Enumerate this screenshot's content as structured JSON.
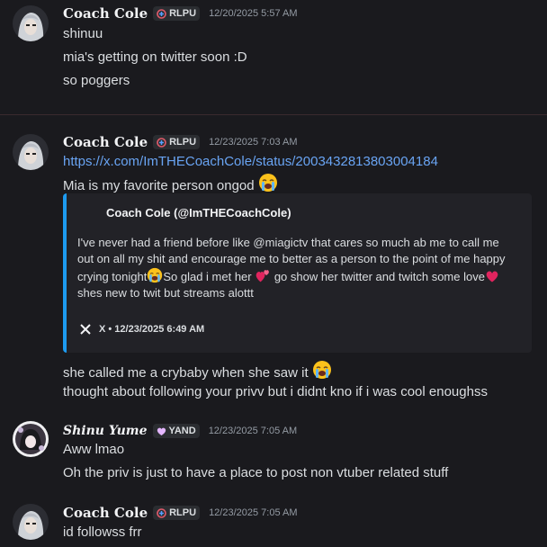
{
  "colors": {
    "background": "#1a1a1e",
    "link": "#69a4f3",
    "embed_accent": "#1d9bf0",
    "heart": "#e0245e"
  },
  "messages": [
    {
      "username": "Coach Cole",
      "tag": "RLPU",
      "timestamp": "12/20/2025 5:57 AM",
      "lines": [
        "shinuu",
        "mia's getting on twitter soon :D",
        "so poggers"
      ]
    },
    {
      "username": "Coach Cole",
      "tag": "RLPU",
      "timestamp": "12/23/2025 7:03 AM",
      "link": "https://x.com/ImTHECoachCole/status/2003432813803004184",
      "line1": "Mia is my favorite person ongod",
      "embed": {
        "author": "Coach Cole (@ImTHECoachCole)",
        "desc_a": "I've never had a friend before like @miagictv that cares so much ab me to call me out on all my shit and encourage me to better as a person to the point of me happy crying tonight",
        "desc_b": "So glad i met her ",
        "desc_c": " go show her twitter and twitch some love",
        "desc_d": "shes new to twit but streams alottt",
        "footer": "X • 12/23/2025 6:49 AM"
      },
      "after_lines": [
        "she called me a crybaby when she saw it",
        "thought about following your privv but i didnt kno if i was cool enoughss"
      ]
    },
    {
      "username": "Shinu Yume",
      "tag": "YAND",
      "timestamp": "12/23/2025 7:05 AM",
      "lines": [
        "Aww lmao",
        "Oh the priv is just to have a place to post non vtuber related stuff"
      ]
    },
    {
      "username": "Coach Cole",
      "tag": "RLPU",
      "timestamp": "12/23/2025 7:05 AM",
      "lines": [
        "id followss frr"
      ]
    }
  ]
}
